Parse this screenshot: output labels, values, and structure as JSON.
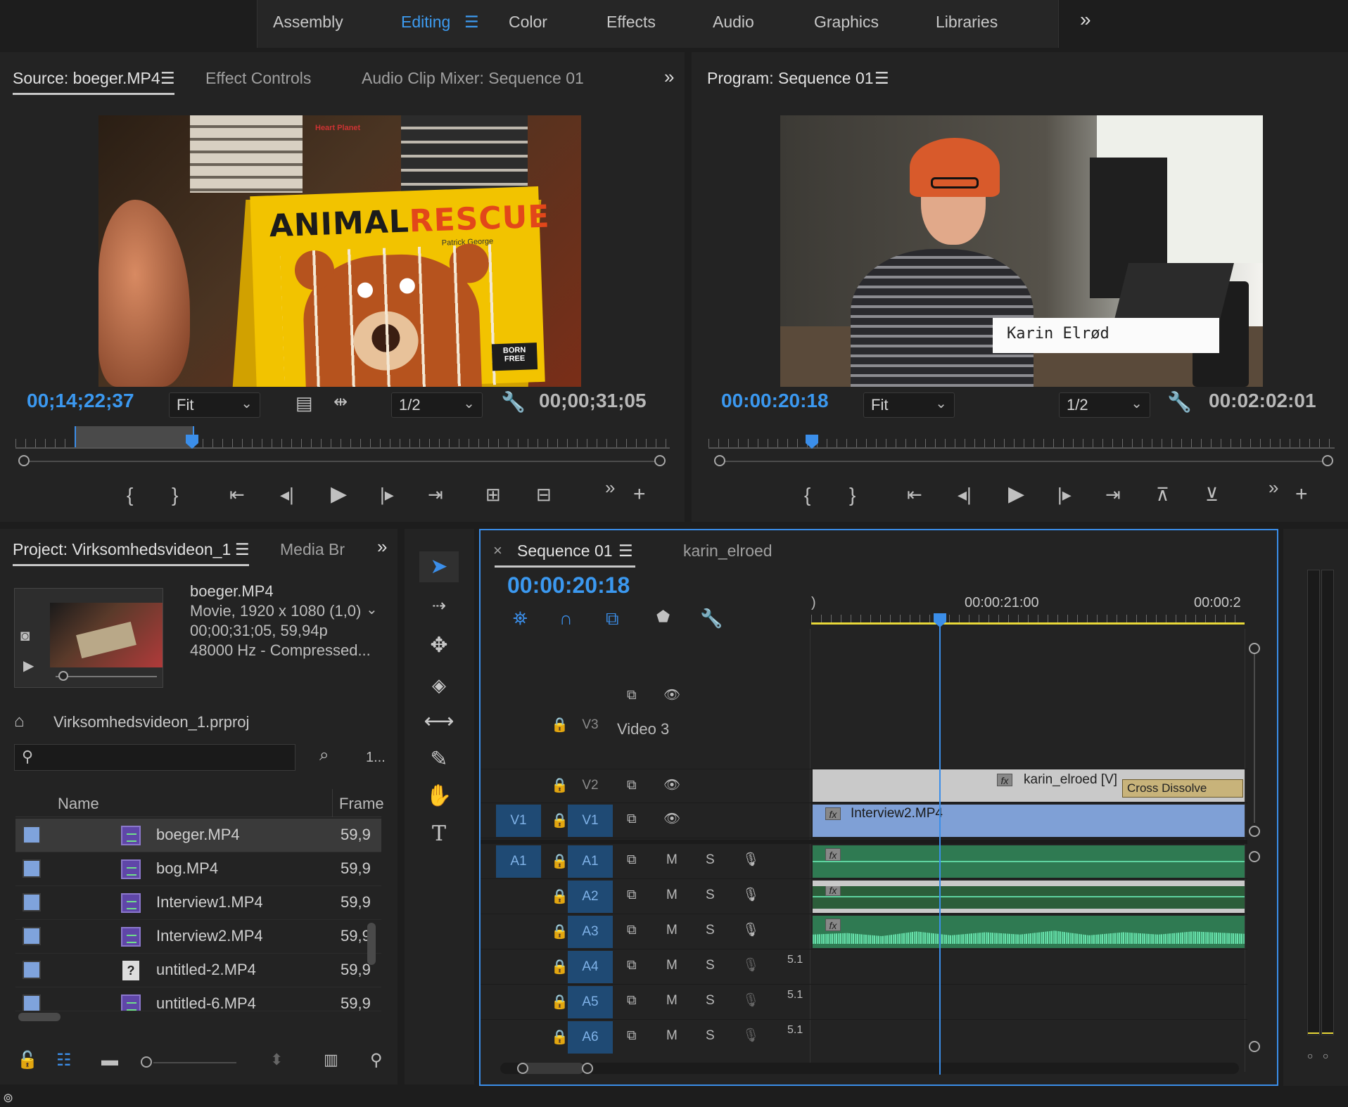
{
  "workspaces": {
    "tabs": [
      "Assembly",
      "Editing",
      "Color",
      "Effects",
      "Audio",
      "Graphics",
      "Libraries"
    ],
    "active": "Editing",
    "overflow": "»"
  },
  "source": {
    "tab_label": "Source: boeger.MP4",
    "tab2": "Effect Controls",
    "tab3": "Audio Clip Mixer: Sequence 01",
    "timecode": "00;14;22;37",
    "fit": "Fit",
    "res": "1/2",
    "duration": "00;00;31;05",
    "book_title_black": "ANIMAL",
    "book_title_orange": "RESCUE",
    "book_author": "Patrick George",
    "book_badge": "BORN FREE",
    "book_publisher": "Heart Planet"
  },
  "program": {
    "tab_label": "Program: Sequence 01",
    "timecode": "00:00:20:18",
    "fit": "Fit",
    "res": "1/2",
    "duration": "00:02:02:01",
    "lower_third": "Karin Elrød"
  },
  "project": {
    "tab_label": "Project: Virksomhedsvideon_1",
    "tab2": "Media Br",
    "clip_name": "boeger.MP4",
    "clip_info1": "Movie, 1920 x 1080 (1,0)",
    "clip_info2": "00;00;31;05, 59,94p",
    "clip_info3": "48000 Hz - Compressed...",
    "project_file": "Virksomhedsvideon_1.prproj",
    "item_count": "1...",
    "search_placeholder": "",
    "col_name": "Name",
    "col_frame": "Frame",
    "items": [
      {
        "name": "boeger.MP4",
        "rate": "59,9"
      },
      {
        "name": "bog.MP4",
        "rate": "59,9"
      },
      {
        "name": "Interview1.MP4",
        "rate": "59,9"
      },
      {
        "name": "Interview2.MP4",
        "rate": "59,9"
      },
      {
        "name": "untitled-2.MP4",
        "rate": "59,9"
      },
      {
        "name": "untitled-6.MP4",
        "rate": "59,9"
      }
    ]
  },
  "timeline": {
    "tab_label": "Sequence 01",
    "tab2": "karin_elroed",
    "close": "×",
    "timecode": "00:00:20:18",
    "ruler_left": ")",
    "ruler_mark1": "00:00:21:00",
    "ruler_mark2": "00:00:2",
    "video_tracks": [
      {
        "id": "V3",
        "name": "Video 3"
      },
      {
        "id": "V2"
      },
      {
        "id": "V1",
        "src": "V1"
      }
    ],
    "audio_tracks": [
      {
        "id": "A1",
        "src": "A1"
      },
      {
        "id": "A2"
      },
      {
        "id": "A3"
      },
      {
        "id": "A4",
        "ch": "5.1"
      },
      {
        "id": "A5",
        "ch": "5.1"
      },
      {
        "id": "A6",
        "ch": "5.1"
      }
    ],
    "m": "M",
    "s": "S",
    "fx": "fx",
    "clips": {
      "v2": "karin_elroed [V]",
      "transition": "Cross Dissolve",
      "v1": "Interview2.MP4"
    }
  },
  "colors": {
    "accent": "#3b98ef",
    "video_clip": "#7fa0d6",
    "audio_clip": "#2f7a52",
    "audio_wave": "#5ed4a0",
    "title_clip": "#c9c9c9",
    "transition": "#c8b37a",
    "work_area": "#e8d839"
  }
}
